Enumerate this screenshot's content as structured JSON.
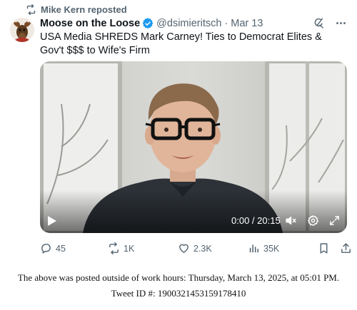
{
  "repost": {
    "label": "Mike Kern reposted"
  },
  "author": {
    "name": "Moose on the Loose",
    "handle": "@dsimieritsch",
    "date": "Mar 13"
  },
  "tweet": {
    "text": "USA Media SHREDS Mark Carney! Ties to Democrat Elites & Gov't $$$ to Wife's Firm"
  },
  "video": {
    "time": "0:00 / 20:15",
    "progress": 0
  },
  "actions": {
    "replies": "45",
    "reposts": "1K",
    "likes": "2.3K",
    "views": "35K"
  },
  "footer": {
    "line1": "The above was posted outside of work hours: Thursday, March 13, 2025, at 05:01 PM.",
    "line2": "Tweet ID #: 1900321453159178410"
  },
  "colors": {
    "text": "#0f1419",
    "secondary": "#536471",
    "verified": "#1d9bf0",
    "background": "#ffffff"
  },
  "icons": [
    "repost-icon",
    "verified-icon",
    "grok-icon",
    "more-icon",
    "play-icon",
    "volume-icon",
    "settings-icon",
    "fullscreen-icon",
    "reply-icon",
    "like-icon",
    "views-icon",
    "bookmark-icon",
    "share-icon"
  ]
}
